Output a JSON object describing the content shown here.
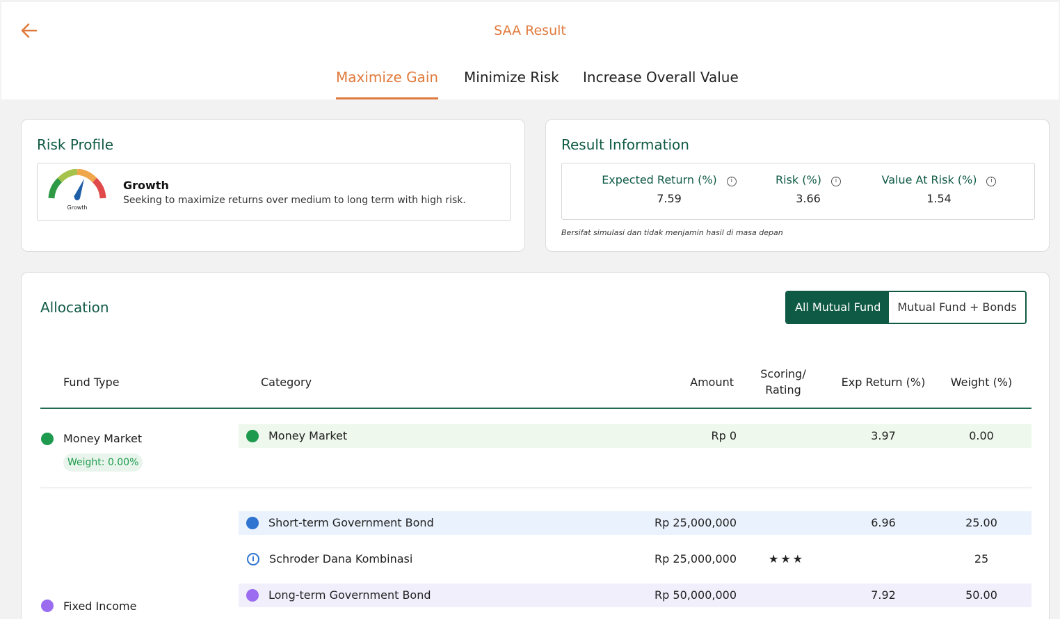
{
  "header": {
    "title": "SAA Result",
    "tabs": [
      {
        "label": "Maximize Gain"
      },
      {
        "label": "Minimize Risk"
      },
      {
        "label": "Increase Overall Value"
      }
    ]
  },
  "risk_profile": {
    "title": "Risk Profile",
    "gauge_label": "Growth",
    "name": "Growth",
    "description": "Seeking to maximize returns over medium to long term with high risk."
  },
  "result_info": {
    "title": "Result Information",
    "metrics": [
      {
        "label": "Expected Return (%)",
        "value": "7.59"
      },
      {
        "label": "Risk (%)",
        "value": "3.66"
      },
      {
        "label": "Value At Risk (%)",
        "value": "1.54"
      }
    ],
    "disclaimer": "Bersifat simulasi dan tidak menjamin hasil di masa depan"
  },
  "allocation": {
    "title": "Allocation",
    "toggle": {
      "active": "All Mutual Fund",
      "inactive": "Mutual Fund + Bonds"
    },
    "columns": {
      "fund_type": "Fund Type",
      "category": "Category",
      "amount": "Amount",
      "scoring_1": "Scoring/",
      "scoring_2": "Rating",
      "exp_return": "Exp Return (%)",
      "weight": "Weight (%)"
    },
    "groups": [
      {
        "fund_type": "Money Market",
        "weight_label": "Weight: 0.00%",
        "color": "#1e9a4f"
      },
      {
        "fund_type": "Fixed Income",
        "color": "#9b6cf0"
      }
    ],
    "rows": [
      {
        "category": "Money Market",
        "amount": "Rp 0",
        "rating": "",
        "exp_return": "3.97",
        "weight": "0.00",
        "color": "#1e9a4f",
        "bg": "#eef8ec"
      },
      {
        "category": "Short-term Government Bond",
        "amount": "Rp 25,000,000",
        "rating": "",
        "exp_return": "6.96",
        "weight": "25.00",
        "color": "#2f74d0",
        "bg": "#eaf2fd"
      },
      {
        "category": "Schroder Dana Kombinasi",
        "amount": "Rp 25,000,000",
        "rating": "★★★",
        "exp_return": "",
        "weight": "25",
        "icon": "info-icon",
        "bg": "#ffffff"
      },
      {
        "category": "Long-term Government Bond",
        "amount": "Rp 50,000,000",
        "rating": "",
        "exp_return": "7.92",
        "weight": "50.00",
        "color": "#9b6cf0",
        "bg": "#f1effc"
      }
    ]
  },
  "colors": {
    "accent": "#e07a3c",
    "primary": "#0f5a44"
  }
}
